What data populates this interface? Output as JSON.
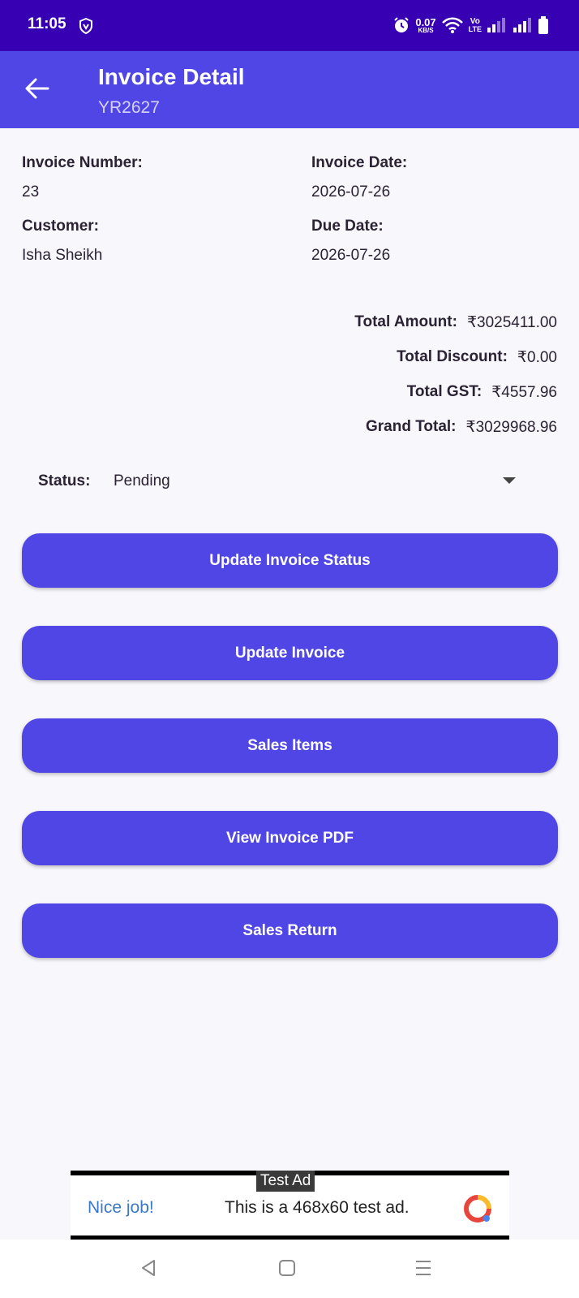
{
  "status_bar": {
    "time": "11:05",
    "net_speed": "0.07",
    "net_unit": "KB/S",
    "volte_top": "Vo",
    "volte_bottom": "LTE"
  },
  "app_bar": {
    "title": "Invoice Detail",
    "subtitle": "YR2627"
  },
  "invoice": {
    "number_label": "Invoice Number:",
    "number": "23",
    "date_label": "Invoice Date:",
    "date": "2026-07-26",
    "customer_label": "Customer:",
    "customer": "Isha Sheikh",
    "due_label": "Due Date:",
    "due": "2026-07-26"
  },
  "totals": {
    "amount_label": "Total Amount:",
    "amount": "₹3025411.00",
    "discount_label": "Total Discount:",
    "discount": "₹0.00",
    "gst_label": "Total GST:",
    "gst": "₹4557.96",
    "grand_label": "Grand Total:",
    "grand": "₹3029968.96"
  },
  "status": {
    "label": "Status:",
    "value": "Pending"
  },
  "buttons": {
    "update_status": "Update Invoice Status",
    "update_invoice": "Update Invoice",
    "sales_items": "Sales Items",
    "view_pdf": "View Invoice PDF",
    "sales_return": "Sales Return"
  },
  "ad": {
    "tag": "Test Ad",
    "nice": "Nice job!",
    "text": "This is a 468x60 test ad."
  },
  "colors": {
    "primary": "#5046e5",
    "status_bar": "#3700b3",
    "background": "#f7f7fc"
  }
}
